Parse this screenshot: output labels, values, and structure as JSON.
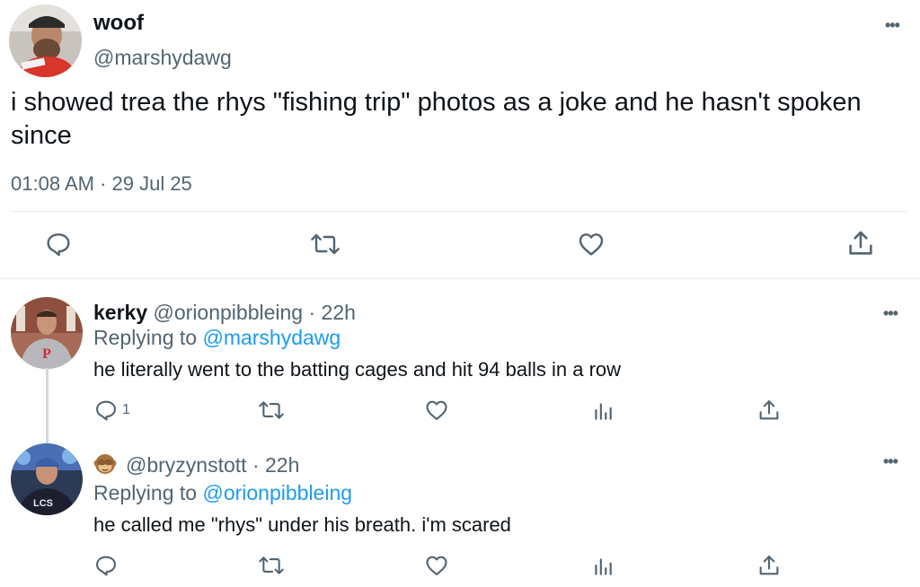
{
  "main_tweet": {
    "display_name": "woof",
    "handle": "@marshydawg",
    "text": "i showed trea the rhys \"fishing trip\" photos as a joke and he hasn't spoken since",
    "timestamp": "01:08 AM · 29 Jul 25",
    "actions": [
      "reply-icon",
      "retweet-icon",
      "like-icon",
      "share-icon"
    ]
  },
  "replies": [
    {
      "display_name": "kerky",
      "handle": "@orionpibbleing",
      "age": "· 22h",
      "replying_label": "Replying to",
      "replying_to": "@marshydawg",
      "text": "he literally went to the batting cages and hit 94 balls in a row",
      "reply_count": "1",
      "actions": [
        "reply-icon",
        "retweet-icon",
        "like-icon",
        "views-icon",
        "share-icon"
      ]
    },
    {
      "display_name": "",
      "name_icon": "see-no-evil-monkey-icon",
      "handle": "@bryzynstott",
      "age": "· 22h",
      "replying_label": "Replying to",
      "replying_to": "@orionpibbleing",
      "text": "he called me \"rhys\" under his breath. i'm scared",
      "actions": [
        "reply-icon",
        "retweet-icon",
        "like-icon",
        "views-icon",
        "share-icon"
      ]
    }
  ],
  "more_label": "•••",
  "colors": {
    "text": "#0f1419",
    "secondary": "#536471",
    "link": "#1d9bf0",
    "divider": "#e6ecf0"
  }
}
